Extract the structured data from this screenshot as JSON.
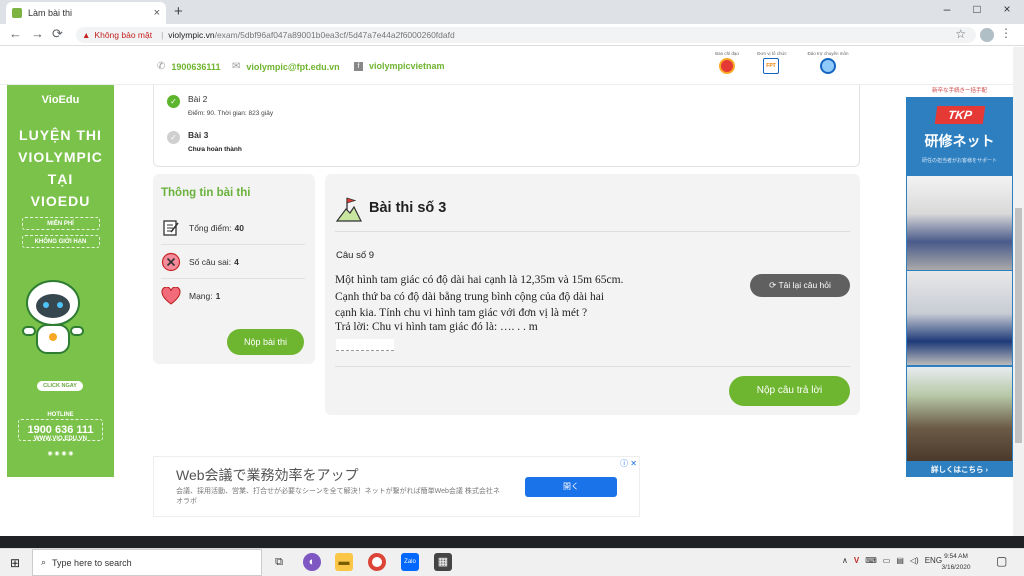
{
  "browser": {
    "tab_title": "Làm bài thi",
    "tab_close": "×",
    "new_tab": "+",
    "insecure_label": "Không bảo mật",
    "url_host": "violympic.vn",
    "url_path": "/exam/5dbf96af047a89001b0ea3cf/5d47a7e44a2f6000260fdafd",
    "window_minimize": "–",
    "window_maximize": "□",
    "window_close": "×"
  },
  "header": {
    "phone": "1900636111",
    "email": "violympic@fpt.edu.vn",
    "facebook": "violympicvietnam",
    "org_labels": [
      "Ban chỉ đạo",
      "Đơn vị tổ chức",
      "Đảo trợ chuyên môn"
    ]
  },
  "left_ad": {
    "brand": "VioEdu",
    "line1": "LUYỆN THI",
    "line2": "VIOLYMPIC",
    "line3": "TẠI",
    "line4": "VIOEDU",
    "pill1": "MIỄN PHÍ",
    "pill2": "KHÔNG GIỚI HẠN",
    "click": "CLICK NGAY",
    "hotline_label": "HOTLINE",
    "hotline": "1900 636 111",
    "website": "WWW.VIO.EDU.VN"
  },
  "right_ad": {
    "top_text": "新卒な手続きー括手配",
    "brand": "TKP",
    "title": "研修ネット",
    "subtitle": "研任の担当者がお客様をサポート",
    "more": "詳しくはこちら ›"
  },
  "progress": {
    "items": [
      {
        "title": "Bài 2",
        "meta": "Điểm: 90. Thời gian: 823 giây",
        "done": true
      },
      {
        "title": "Bài 3",
        "meta": "Chưa hoàn thành",
        "done": false
      }
    ]
  },
  "info": {
    "title": "Thông tin bài thi",
    "score_label": "Tổng điểm:",
    "score_value": "40",
    "wrong_label": "Số câu sai:",
    "wrong_value": "4",
    "lives_label": "Mạng:",
    "lives_value": "1",
    "submit_label": "Nộp bài thi"
  },
  "exam": {
    "title": "Bài thi số 3",
    "question_no": "Câu số 9",
    "question_lines": [
      "Một hình tam giác có độ dài hai cạnh là 12,35m và 15m 65cm.",
      "Cạnh thứ ba có độ dài bằng trung bình cộng của độ dài hai",
      "cạnh kia. Tính chu vi hình tam giác với đơn vị là mét ?"
    ],
    "answer_prefix": "Trả lời: Chu vi hình tam giác đó là:  …. . . m",
    "reload_label": "⟳ Tải lại câu hỏi",
    "submit_answer_label": "Nộp câu trả lời"
  },
  "bottom_ad": {
    "headline": "Web会議で業務効率をアップ",
    "desc": "会議、採用活動、営業、打合せが必要なシーンを全て解決！ネットが繋がれば簡単Web会議 株式会社ネオラボ",
    "button": "開く",
    "ad_choices": "ⓘ ✕"
  },
  "taskbar": {
    "search_placeholder": "Type here to search",
    "tray_lang": "ENG",
    "time": "9:54 AM",
    "date": "3/16/2020"
  },
  "colors": {
    "brand_green": "#6fb630",
    "gray_button": "#606060",
    "ad_blue": "#2d7fc0"
  }
}
